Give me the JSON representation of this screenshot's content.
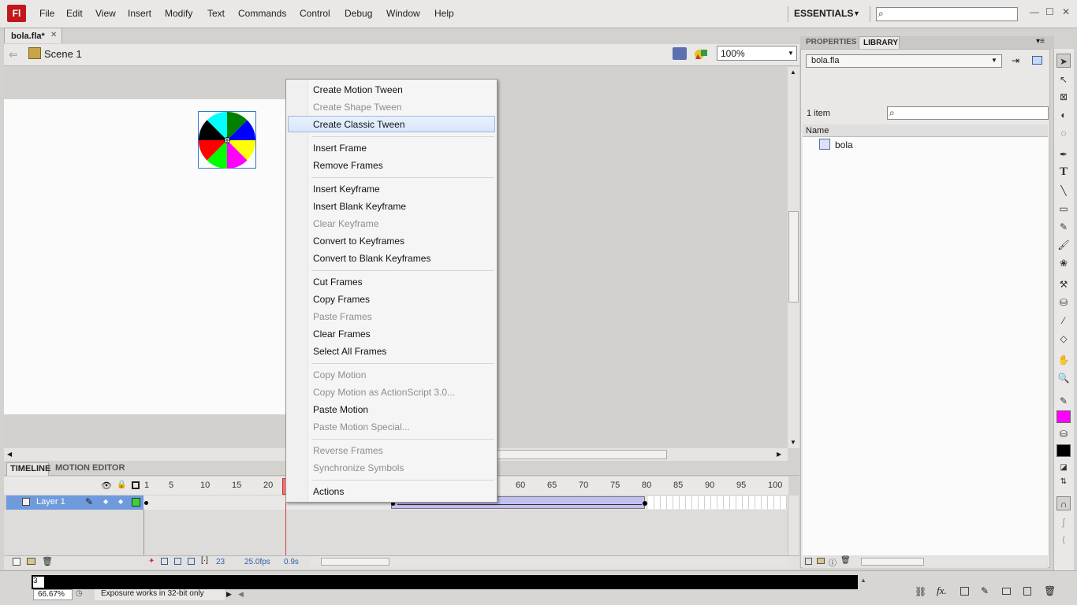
{
  "app": {
    "logo_text": "Fl",
    "menu": [
      "File",
      "Edit",
      "View",
      "Insert",
      "Modify",
      "Text",
      "Commands",
      "Control",
      "Debug",
      "Window",
      "Help"
    ],
    "workspace": "ESSENTIALS"
  },
  "document": {
    "tab_label": "bola.fla*",
    "scene_label": "Scene 1",
    "zoom": "100%"
  },
  "timeline": {
    "tabs": [
      "TIMELINE",
      "MOTION EDITOR"
    ],
    "layer_name": "Layer 1",
    "ruler_numbers": [
      "1",
      "5",
      "10",
      "15",
      "20",
      "60",
      "65",
      "70",
      "75",
      "80",
      "85",
      "90",
      "95",
      "100"
    ],
    "current_frame": "23",
    "fps": "25.0fps",
    "elapsed": "0.9s"
  },
  "library": {
    "tabs": [
      "PROPERTIES",
      "LIBRARY"
    ],
    "selected_doc": "bola.fla",
    "item_count": "1 item",
    "column_name": "Name",
    "items": [
      {
        "name": "bola"
      }
    ]
  },
  "colors": {
    "stroke": "#ff00ff",
    "fill": "#000000",
    "ball": [
      "#00ffff",
      "#008000",
      "#0000ff",
      "#ffff00",
      "#ff00ff",
      "#00ff00",
      "#ff0000",
      "#000000"
    ]
  },
  "status": {
    "output_value": "3",
    "zoom": "66.67%",
    "message": "Exposure works in 32-bit only"
  },
  "context_menu": {
    "items": [
      {
        "label": "Create Motion Tween",
        "enabled": true
      },
      {
        "label": "Create Shape Tween",
        "enabled": false
      },
      {
        "label": "Create Classic Tween",
        "enabled": true,
        "highlighted": true
      },
      {
        "label": "Insert Frame",
        "enabled": true
      },
      {
        "label": "Remove Frames",
        "enabled": true
      },
      {
        "label": "Insert Keyframe",
        "enabled": true
      },
      {
        "label": "Insert Blank Keyframe",
        "enabled": true
      },
      {
        "label": "Clear Keyframe",
        "enabled": false
      },
      {
        "label": "Convert to Keyframes",
        "enabled": true
      },
      {
        "label": "Convert to Blank Keyframes",
        "enabled": true
      },
      {
        "label": "Cut Frames",
        "enabled": true
      },
      {
        "label": "Copy Frames",
        "enabled": true
      },
      {
        "label": "Paste Frames",
        "enabled": false
      },
      {
        "label": "Clear Frames",
        "enabled": true
      },
      {
        "label": "Select All Frames",
        "enabled": true
      },
      {
        "label": "Copy Motion",
        "enabled": false
      },
      {
        "label": "Copy Motion as ActionScript 3.0...",
        "enabled": false
      },
      {
        "label": "Paste Motion",
        "enabled": true
      },
      {
        "label": "Paste Motion Special...",
        "enabled": false
      },
      {
        "label": "Reverse Frames",
        "enabled": false
      },
      {
        "label": "Synchronize Symbols",
        "enabled": false
      },
      {
        "label": "Actions",
        "enabled": true
      }
    ]
  }
}
